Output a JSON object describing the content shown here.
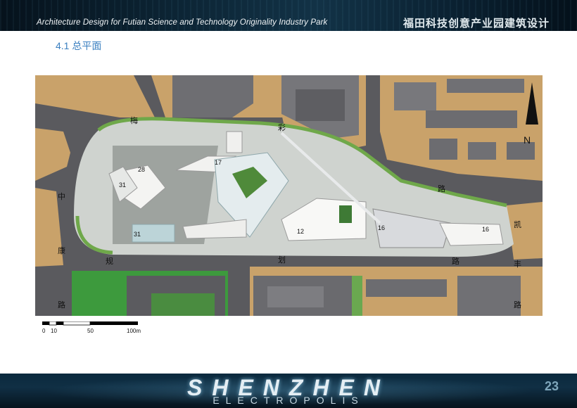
{
  "header": {
    "title_en": "Architecture Design for Futian Science and Technology Originality Industry Park",
    "title_cn": "福田科技创意产业园建筑设计"
  },
  "section": {
    "title": "4.1 总平面"
  },
  "plan": {
    "street_chars": {
      "mei": "梅",
      "cai": "彩",
      "lu_right": "路",
      "zhong": "中",
      "kang": "康",
      "lu_left": "路",
      "gui": "规",
      "hua": "划",
      "lu_bottom": "路",
      "kai": "凯",
      "feng": "丰",
      "lu_far": "路"
    },
    "building_labels": [
      "28",
      "31",
      "17",
      "31",
      "12",
      "16",
      "16"
    ],
    "north_label": "N"
  },
  "scale_bar": {
    "ticks": [
      "0",
      "10",
      "50",
      "100m"
    ]
  },
  "footer": {
    "brand": "SHENZHEN",
    "brand_sub": "ELECTROPOLIS",
    "page_number": "23"
  }
}
